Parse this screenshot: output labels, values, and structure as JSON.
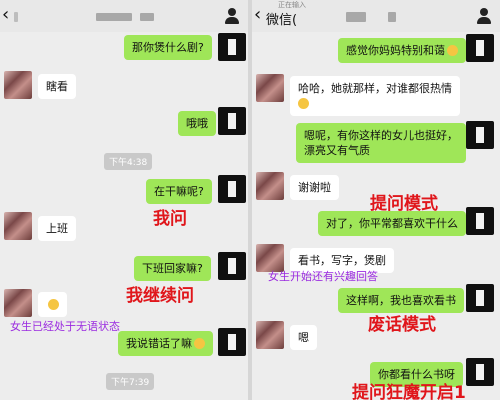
{
  "right_header": {
    "title": "微信(",
    "sub_label": "正在输入"
  },
  "left_messages": {
    "m1": "那你煲什么剧?",
    "m2": "瞎看",
    "m3": "哦哦",
    "t1": "下午4:38",
    "m4": "在干嘛呢?",
    "m5": "上班",
    "m6": "下班回家嘛?",
    "m7": "",
    "m8": "我说错话了嘛",
    "t2": "下午7:39"
  },
  "left_annotations": {
    "a1": "我问",
    "a2": "我继续问",
    "a3": "女生已经处于无语状态"
  },
  "right_messages": {
    "m1": "感觉你妈妈特别和蔼",
    "m2_line1": "哈哈，她就那样，对谁都很热情",
    "m3_line1": "嗯呢，有你这样的女儿也挺好，",
    "m3_line2": "漂亮又有气质",
    "m4": "谢谢啦",
    "m5": "对了，你平常都喜欢干什么",
    "m6": "看书，写字，煲剧",
    "m7": "这样啊，我也喜欢看书",
    "m8": "嗯",
    "m9": "你都看什么书呀"
  },
  "right_annotations": {
    "a1": "提问模式",
    "a2": "女生开始还有兴趣回答",
    "a3": "废话模式",
    "a4": "提问狂魔开启1"
  },
  "colors": {
    "sent_bubble": "#9fe658",
    "recv_bubble": "#ffffff",
    "red_annotation": "#e0161b",
    "purple_annotation": "#9b2be0"
  }
}
